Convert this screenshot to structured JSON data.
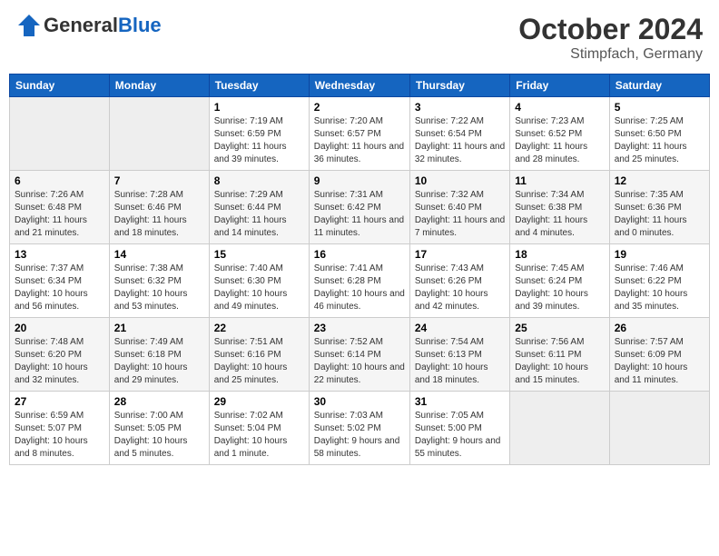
{
  "header": {
    "logo": {
      "general": "General",
      "blue": "Blue"
    },
    "title": "October 2024",
    "location": "Stimpfach, Germany"
  },
  "calendar": {
    "days_of_week": [
      "Sunday",
      "Monday",
      "Tuesday",
      "Wednesday",
      "Thursday",
      "Friday",
      "Saturday"
    ],
    "weeks": [
      [
        {
          "day": "",
          "empty": true
        },
        {
          "day": "",
          "empty": true
        },
        {
          "day": "1",
          "sunrise": "Sunrise: 7:19 AM",
          "sunset": "Sunset: 6:59 PM",
          "daylight": "Daylight: 11 hours and 39 minutes."
        },
        {
          "day": "2",
          "sunrise": "Sunrise: 7:20 AM",
          "sunset": "Sunset: 6:57 PM",
          "daylight": "Daylight: 11 hours and 36 minutes."
        },
        {
          "day": "3",
          "sunrise": "Sunrise: 7:22 AM",
          "sunset": "Sunset: 6:54 PM",
          "daylight": "Daylight: 11 hours and 32 minutes."
        },
        {
          "day": "4",
          "sunrise": "Sunrise: 7:23 AM",
          "sunset": "Sunset: 6:52 PM",
          "daylight": "Daylight: 11 hours and 28 minutes."
        },
        {
          "day": "5",
          "sunrise": "Sunrise: 7:25 AM",
          "sunset": "Sunset: 6:50 PM",
          "daylight": "Daylight: 11 hours and 25 minutes."
        }
      ],
      [
        {
          "day": "6",
          "sunrise": "Sunrise: 7:26 AM",
          "sunset": "Sunset: 6:48 PM",
          "daylight": "Daylight: 11 hours and 21 minutes."
        },
        {
          "day": "7",
          "sunrise": "Sunrise: 7:28 AM",
          "sunset": "Sunset: 6:46 PM",
          "daylight": "Daylight: 11 hours and 18 minutes."
        },
        {
          "day": "8",
          "sunrise": "Sunrise: 7:29 AM",
          "sunset": "Sunset: 6:44 PM",
          "daylight": "Daylight: 11 hours and 14 minutes."
        },
        {
          "day": "9",
          "sunrise": "Sunrise: 7:31 AM",
          "sunset": "Sunset: 6:42 PM",
          "daylight": "Daylight: 11 hours and 11 minutes."
        },
        {
          "day": "10",
          "sunrise": "Sunrise: 7:32 AM",
          "sunset": "Sunset: 6:40 PM",
          "daylight": "Daylight: 11 hours and 7 minutes."
        },
        {
          "day": "11",
          "sunrise": "Sunrise: 7:34 AM",
          "sunset": "Sunset: 6:38 PM",
          "daylight": "Daylight: 11 hours and 4 minutes."
        },
        {
          "day": "12",
          "sunrise": "Sunrise: 7:35 AM",
          "sunset": "Sunset: 6:36 PM",
          "daylight": "Daylight: 11 hours and 0 minutes."
        }
      ],
      [
        {
          "day": "13",
          "sunrise": "Sunrise: 7:37 AM",
          "sunset": "Sunset: 6:34 PM",
          "daylight": "Daylight: 10 hours and 56 minutes."
        },
        {
          "day": "14",
          "sunrise": "Sunrise: 7:38 AM",
          "sunset": "Sunset: 6:32 PM",
          "daylight": "Daylight: 10 hours and 53 minutes."
        },
        {
          "day": "15",
          "sunrise": "Sunrise: 7:40 AM",
          "sunset": "Sunset: 6:30 PM",
          "daylight": "Daylight: 10 hours and 49 minutes."
        },
        {
          "day": "16",
          "sunrise": "Sunrise: 7:41 AM",
          "sunset": "Sunset: 6:28 PM",
          "daylight": "Daylight: 10 hours and 46 minutes."
        },
        {
          "day": "17",
          "sunrise": "Sunrise: 7:43 AM",
          "sunset": "Sunset: 6:26 PM",
          "daylight": "Daylight: 10 hours and 42 minutes."
        },
        {
          "day": "18",
          "sunrise": "Sunrise: 7:45 AM",
          "sunset": "Sunset: 6:24 PM",
          "daylight": "Daylight: 10 hours and 39 minutes."
        },
        {
          "day": "19",
          "sunrise": "Sunrise: 7:46 AM",
          "sunset": "Sunset: 6:22 PM",
          "daylight": "Daylight: 10 hours and 35 minutes."
        }
      ],
      [
        {
          "day": "20",
          "sunrise": "Sunrise: 7:48 AM",
          "sunset": "Sunset: 6:20 PM",
          "daylight": "Daylight: 10 hours and 32 minutes."
        },
        {
          "day": "21",
          "sunrise": "Sunrise: 7:49 AM",
          "sunset": "Sunset: 6:18 PM",
          "daylight": "Daylight: 10 hours and 29 minutes."
        },
        {
          "day": "22",
          "sunrise": "Sunrise: 7:51 AM",
          "sunset": "Sunset: 6:16 PM",
          "daylight": "Daylight: 10 hours and 25 minutes."
        },
        {
          "day": "23",
          "sunrise": "Sunrise: 7:52 AM",
          "sunset": "Sunset: 6:14 PM",
          "daylight": "Daylight: 10 hours and 22 minutes."
        },
        {
          "day": "24",
          "sunrise": "Sunrise: 7:54 AM",
          "sunset": "Sunset: 6:13 PM",
          "daylight": "Daylight: 10 hours and 18 minutes."
        },
        {
          "day": "25",
          "sunrise": "Sunrise: 7:56 AM",
          "sunset": "Sunset: 6:11 PM",
          "daylight": "Daylight: 10 hours and 15 minutes."
        },
        {
          "day": "26",
          "sunrise": "Sunrise: 7:57 AM",
          "sunset": "Sunset: 6:09 PM",
          "daylight": "Daylight: 10 hours and 11 minutes."
        }
      ],
      [
        {
          "day": "27",
          "sunrise": "Sunrise: 6:59 AM",
          "sunset": "Sunset: 5:07 PM",
          "daylight": "Daylight: 10 hours and 8 minutes."
        },
        {
          "day": "28",
          "sunrise": "Sunrise: 7:00 AM",
          "sunset": "Sunset: 5:05 PM",
          "daylight": "Daylight: 10 hours and 5 minutes."
        },
        {
          "day": "29",
          "sunrise": "Sunrise: 7:02 AM",
          "sunset": "Sunset: 5:04 PM",
          "daylight": "Daylight: 10 hours and 1 minute."
        },
        {
          "day": "30",
          "sunrise": "Sunrise: 7:03 AM",
          "sunset": "Sunset: 5:02 PM",
          "daylight": "Daylight: 9 hours and 58 minutes."
        },
        {
          "day": "31",
          "sunrise": "Sunrise: 7:05 AM",
          "sunset": "Sunset: 5:00 PM",
          "daylight": "Daylight: 9 hours and 55 minutes."
        },
        {
          "day": "",
          "empty": true
        },
        {
          "day": "",
          "empty": true
        }
      ]
    ]
  }
}
